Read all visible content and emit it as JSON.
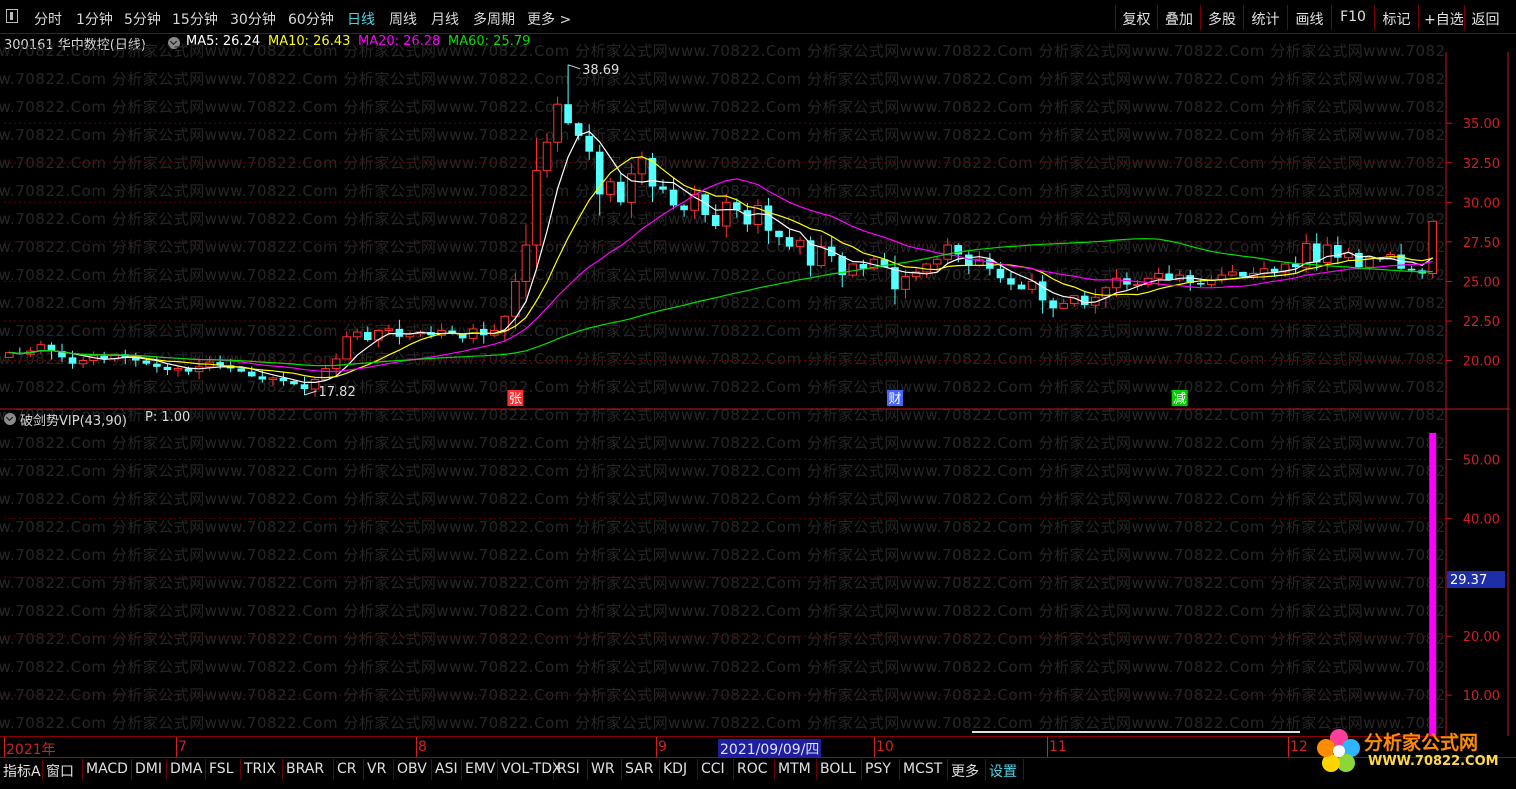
{
  "toolbar": {
    "periods": [
      {
        "label": "分时",
        "active": false
      },
      {
        "label": "1分钟",
        "active": false
      },
      {
        "label": "5分钟",
        "active": false
      },
      {
        "label": "15分钟",
        "active": false
      },
      {
        "label": "30分钟",
        "active": false
      },
      {
        "label": "60分钟",
        "active": false
      },
      {
        "label": "日线",
        "active": true
      },
      {
        "label": "周线",
        "active": false
      },
      {
        "label": "月线",
        "active": false
      },
      {
        "label": "多周期",
        "active": false
      },
      {
        "label": "更多 >",
        "active": false
      }
    ],
    "right_buttons": [
      "复权",
      "叠加",
      "多股",
      "统计",
      "画线",
      "F10",
      "标记",
      "+自选",
      "返回"
    ]
  },
  "info": {
    "stock": "300161 华中数控(日线)",
    "ma5": "MA5: 26.24",
    "ma10": "MA10: 26.43",
    "ma20": "MA20: 26.28",
    "ma60": "MA60: 25.79"
  },
  "indicator": {
    "name": "破剑势VIP(43,90)",
    "p": "P: 1.00",
    "current_value_label": "29.37"
  },
  "watermark": "分析家公式网www.70822.Com",
  "colors": {
    "up": "#ff3030",
    "down": "#54ffff",
    "ma5": "#ffffff",
    "ma10": "#ffff00",
    "ma20": "#ff00ff",
    "ma60": "#00e000",
    "indicator_bar": "#ff00ff",
    "axis": "#d02020"
  },
  "markers": [
    {
      "label": "张",
      "color": "#ff3030",
      "date_index": 91
    },
    {
      "label": "财",
      "color": "#4466ff",
      "date_index": 160
    },
    {
      "label": "减",
      "color": "#00d000",
      "date_index": 213
    }
  ],
  "dates": {
    "labels": [
      "2021年",
      "7",
      "8",
      "9",
      "10",
      "11",
      "12"
    ],
    "highlight": "2021/09/09/四"
  },
  "bottom_tabs": [
    "指标A",
    "窗口",
    "MACD",
    "DMI",
    "DMA",
    "FSL",
    "TRIX",
    "BRAR",
    "CR",
    "VR",
    "OBV",
    "ASI",
    "EMV",
    "VOL-TDX",
    "RSI",
    "WR",
    "SAR",
    "KDJ",
    "CCI",
    "ROC",
    "MTM",
    "BOLL",
    "PSY",
    "MCST",
    "更多",
    "设置"
  ],
  "logo": {
    "text": "分析家公式网",
    "url": "WWW.70822.COM"
  },
  "chart_data": [
    {
      "type": "candlestick",
      "title": "",
      "y_ticks": [
        35.0,
        32.5,
        30.0,
        27.5,
        25.0,
        22.5,
        20.0
      ],
      "ylim": [
        17.0,
        39.5
      ],
      "annotations": [
        {
          "text": "38.69",
          "value": 38.69,
          "kind": "high"
        },
        {
          "text": "17.82",
          "value": 17.82,
          "kind": "low"
        }
      ],
      "series": [
        {
          "name": "MA5",
          "values": []
        },
        {
          "name": "MA10",
          "values": []
        },
        {
          "name": "MA20",
          "values": []
        },
        {
          "name": "MA60",
          "values": []
        }
      ],
      "candles_open": [
        20.2,
        20.5,
        20.4,
        20.6,
        21.0,
        20.6,
        20.2,
        19.8,
        20.0,
        20.3,
        20.1,
        20.4,
        20.2,
        20.0,
        19.8,
        19.6,
        19.4,
        19.5,
        19.3,
        19.6,
        19.9,
        19.7,
        19.5,
        19.3,
        19.0,
        18.8,
        18.9,
        18.7,
        18.5,
        18.2,
        18.8,
        19.5,
        20.1,
        21.5,
        21.8,
        21.3,
        21.9,
        22.0,
        21.5,
        21.7,
        21.8,
        21.6,
        21.9,
        21.7,
        21.4,
        22.0,
        21.6,
        21.9,
        22.8,
        25.0,
        27.3,
        32.0,
        33.8,
        36.2,
        35.0,
        34.2,
        33.2,
        30.5,
        31.3,
        30.0,
        31.8,
        32.8,
        31.0,
        30.8,
        29.8,
        29.5,
        30.5,
        29.2,
        28.5,
        30.0,
        29.5,
        28.6,
        29.8,
        28.2,
        27.8,
        27.2,
        27.6,
        26.0,
        27.2,
        26.6,
        25.4,
        26.1,
        25.8,
        26.4,
        25.9,
        24.5,
        25.3,
        25.6,
        26.1,
        26.4,
        27.3,
        26.7,
        26.0,
        26.4,
        25.8,
        25.2,
        24.8,
        24.5,
        25.0,
        23.8,
        23.3,
        23.6,
        24.1,
        23.5,
        24.0,
        24.6,
        25.2,
        24.8,
        24.8,
        25.2,
        25.5,
        25.1,
        25.4,
        24.9,
        24.8,
        25.1,
        25.4,
        25.6,
        25.3,
        25.5,
        25.8,
        25.6,
        26.1,
        25.9,
        27.4,
        26.2,
        27.3,
        26.5,
        26.8,
        25.9,
        26.5,
        26.4,
        26.7,
        25.8,
        25.7,
        25.5
      ],
      "candles_close": [
        20.5,
        20.4,
        20.6,
        21.0,
        20.6,
        20.2,
        19.8,
        20.0,
        20.3,
        20.1,
        20.4,
        20.2,
        20.0,
        19.8,
        19.6,
        19.4,
        19.5,
        19.3,
        19.6,
        19.9,
        19.7,
        19.5,
        19.3,
        19.0,
        18.8,
        18.9,
        18.7,
        18.5,
        18.2,
        18.8,
        19.5,
        20.1,
        21.5,
        21.8,
        21.3,
        21.9,
        22.0,
        21.5,
        21.7,
        21.8,
        21.6,
        21.9,
        21.7,
        21.4,
        22.0,
        21.6,
        21.9,
        22.8,
        25.0,
        27.3,
        32.0,
        33.8,
        36.2,
        35.0,
        34.2,
        33.2,
        30.5,
        31.3,
        30.0,
        31.8,
        32.8,
        31.0,
        30.8,
        29.8,
        29.5,
        30.5,
        29.2,
        28.5,
        30.0,
        29.5,
        28.6,
        29.8,
        28.2,
        27.8,
        27.2,
        27.6,
        26.0,
        27.2,
        26.6,
        25.4,
        26.1,
        25.8,
        26.4,
        25.9,
        24.5,
        25.3,
        25.6,
        26.1,
        26.4,
        27.3,
        26.7,
        26.0,
        26.4,
        25.8,
        25.2,
        24.8,
        24.5,
        25.0,
        23.8,
        23.3,
        23.6,
        24.1,
        23.5,
        24.0,
        24.6,
        25.2,
        24.8,
        24.8,
        25.2,
        25.5,
        25.1,
        25.4,
        24.9,
        24.8,
        25.1,
        25.4,
        25.6,
        25.3,
        25.5,
        25.8,
        25.6,
        26.1,
        25.9,
        27.4,
        26.2,
        27.3,
        26.5,
        26.8,
        25.9,
        26.5,
        26.4,
        26.7,
        25.8,
        25.7,
        25.5,
        28.8
      ]
    },
    {
      "type": "bar",
      "title": "",
      "y_ticks": [
        50.0,
        40.0,
        30.0,
        20.0,
        10.0
      ],
      "ylim": [
        0,
        55.0
      ],
      "series": [
        {
          "name": "破剑势VIP",
          "values": [
            29.37
          ]
        }
      ]
    }
  ]
}
